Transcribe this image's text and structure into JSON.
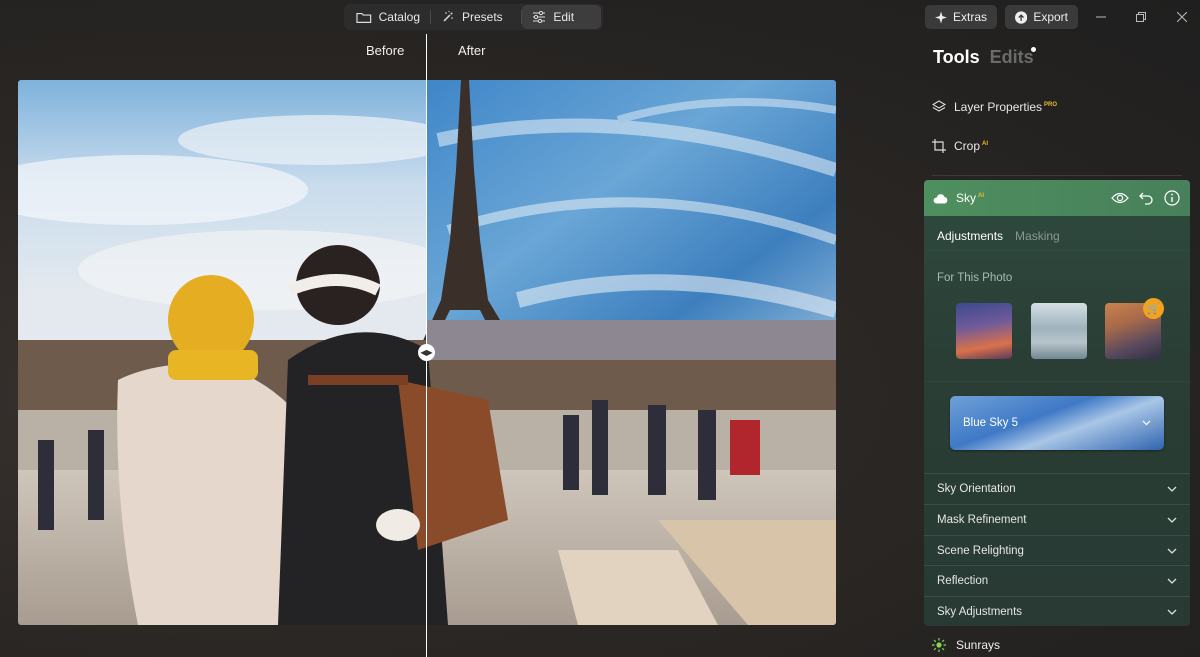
{
  "top_bar": {
    "tabs": [
      {
        "label": "Catalog",
        "icon": "folder-icon"
      },
      {
        "label": "Presets",
        "icon": "magic-wand-icon"
      },
      {
        "label": "Edit",
        "icon": "sliders-icon"
      }
    ],
    "active_tab": "Edit",
    "extras_label": "Extras",
    "export_label": "Export"
  },
  "canvas": {
    "before_label": "Before",
    "after_label": "After",
    "split_position": 0.5
  },
  "panel": {
    "title_tools": "Tools",
    "title_edits": "Edits",
    "tools": [
      {
        "label": "Layer Properties",
        "badge": "PRO",
        "icon": "layers-icon"
      },
      {
        "label": "Crop",
        "badge": "AI",
        "icon": "crop-icon"
      }
    ],
    "sky": {
      "label": "Sky",
      "badge": "AI",
      "tabs": [
        "Adjustments",
        "Masking"
      ],
      "active_tab": "Adjustments",
      "section_title": "For This Photo",
      "selected_preset": "Blue Sky 5",
      "accordions": [
        "Sky Orientation",
        "Mask Refinement",
        "Scene Relighting",
        "Reflection",
        "Sky Adjustments"
      ]
    },
    "next_tool": "Sunrays"
  },
  "colors": {
    "accent_green": "#4f8f5f",
    "pro_badge": "#e9b92c",
    "cart_badge": "#f2a21e",
    "sunrays_icon": "#7ed957"
  }
}
